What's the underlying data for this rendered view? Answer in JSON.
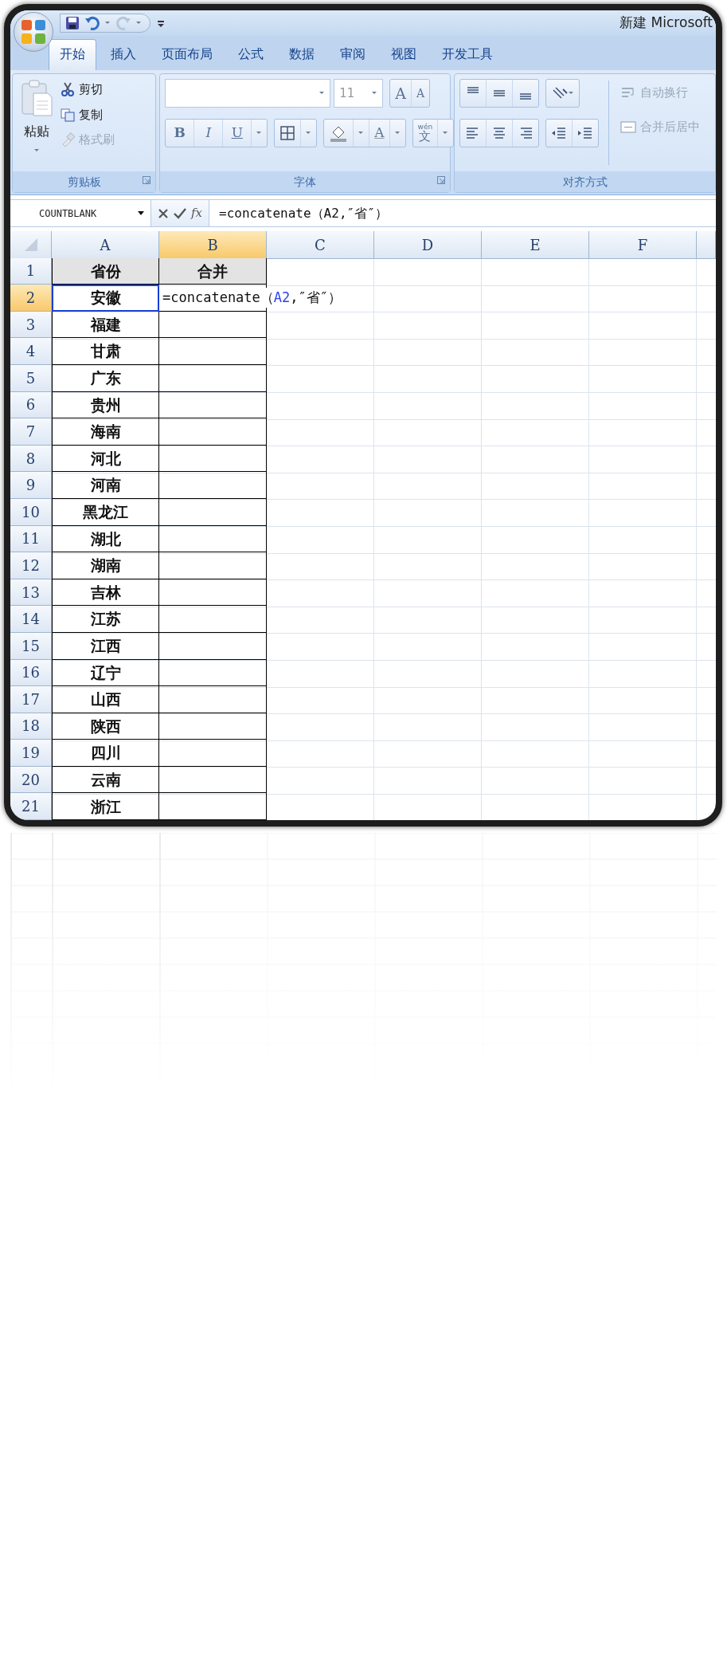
{
  "window": {
    "title": "新建 Microsoft"
  },
  "quick_access": [
    {
      "kind": "save",
      "disabled": false
    },
    {
      "kind": "undo",
      "disabled": false
    },
    {
      "kind": "redo",
      "disabled": true
    }
  ],
  "tabs": [
    {
      "label": "开始",
      "selected": true
    },
    {
      "label": "插入",
      "selected": false
    },
    {
      "label": "页面布局",
      "selected": false
    },
    {
      "label": "公式",
      "selected": false
    },
    {
      "label": "数据",
      "selected": false
    },
    {
      "label": "审阅",
      "selected": false
    },
    {
      "label": "视图",
      "selected": false
    },
    {
      "label": "开发工具",
      "selected": false
    }
  ],
  "ribbon": {
    "clipboard": {
      "label": "剪贴板",
      "paste": "粘贴",
      "items": [
        {
          "kind": "cut",
          "label": "剪切",
          "disabled": false
        },
        {
          "kind": "copy",
          "label": "复制",
          "disabled": false
        },
        {
          "kind": "painter",
          "label": "格式刷",
          "disabled": true
        }
      ]
    },
    "font": {
      "label": "字体",
      "size": "11",
      "grow": "A",
      "shrink": "A",
      "styles": [
        {
          "kind": "bold",
          "text": "B"
        },
        {
          "kind": "italic",
          "text": "I"
        },
        {
          "kind": "underline",
          "text": "U"
        }
      ],
      "font_color": "A",
      "phonetic": {
        "top": "wén",
        "main": "文"
      }
    },
    "alignment": {
      "label": "对齐方式",
      "items": [
        {
          "kind": "wrap",
          "label": "自动换行",
          "disabled": true
        },
        {
          "kind": "merge",
          "label": "合并后居中",
          "disabled": true
        }
      ]
    }
  },
  "formula_bar": {
    "name_box": "COUNTBLANK",
    "fx": "fx",
    "formula": "=concatenate（A2,″省″）"
  },
  "columns": [
    {
      "label": "A",
      "selected": false
    },
    {
      "label": "B",
      "selected": true
    },
    {
      "label": "C",
      "selected": false
    },
    {
      "label": "D",
      "selected": false
    },
    {
      "label": "E",
      "selected": false
    },
    {
      "label": "F",
      "selected": false
    }
  ],
  "rows": [
    {
      "number": "1",
      "selected": false,
      "kind": "header",
      "outlined": false,
      "a": "省份",
      "b": "合并"
    },
    {
      "number": "2",
      "selected": true,
      "kind": "data",
      "outlined": true,
      "a": "安徽",
      "b_parts": [
        {
          "kind": "plain",
          "text": "=concatenate（"
        },
        {
          "kind": "ref",
          "text": "A2"
        },
        {
          "kind": "plain",
          "text": ",″省″）"
        }
      ]
    },
    {
      "number": "3",
      "selected": false,
      "kind": "data",
      "outlined": false,
      "a": "福建"
    },
    {
      "number": "4",
      "selected": false,
      "kind": "data",
      "outlined": false,
      "a": "甘肃"
    },
    {
      "number": "5",
      "selected": false,
      "kind": "data",
      "outlined": false,
      "a": "广东"
    },
    {
      "number": "6",
      "selected": false,
      "kind": "data",
      "outlined": false,
      "a": "贵州"
    },
    {
      "number": "7",
      "selected": false,
      "kind": "data",
      "outlined": false,
      "a": "海南"
    },
    {
      "number": "8",
      "selected": false,
      "kind": "data",
      "outlined": false,
      "a": "河北"
    },
    {
      "number": "9",
      "selected": false,
      "kind": "data",
      "outlined": false,
      "a": "河南"
    },
    {
      "number": "10",
      "selected": false,
      "kind": "data",
      "outlined": false,
      "a": "黑龙江"
    },
    {
      "number": "11",
      "selected": false,
      "kind": "data",
      "outlined": false,
      "a": "湖北"
    },
    {
      "number": "12",
      "selected": false,
      "kind": "data",
      "outlined": false,
      "a": "湖南"
    },
    {
      "number": "13",
      "selected": false,
      "kind": "data",
      "outlined": false,
      "a": "吉林"
    },
    {
      "number": "14",
      "selected": false,
      "kind": "data",
      "outlined": false,
      "a": "江苏"
    },
    {
      "number": "15",
      "selected": false,
      "kind": "data",
      "outlined": false,
      "a": "江西"
    },
    {
      "number": "16",
      "selected": false,
      "kind": "data",
      "outlined": false,
      "a": "辽宁"
    },
    {
      "number": "17",
      "selected": false,
      "kind": "data",
      "outlined": false,
      "a": "山西"
    },
    {
      "number": "18",
      "selected": false,
      "kind": "data",
      "outlined": false,
      "a": "陕西"
    },
    {
      "number": "19",
      "selected": false,
      "kind": "data",
      "outlined": false,
      "a": "四川"
    },
    {
      "number": "20",
      "selected": false,
      "kind": "data",
      "outlined": false,
      "a": "云南"
    },
    {
      "number": "21",
      "selected": false,
      "kind": "data",
      "outlined": false,
      "a": "浙江"
    }
  ]
}
